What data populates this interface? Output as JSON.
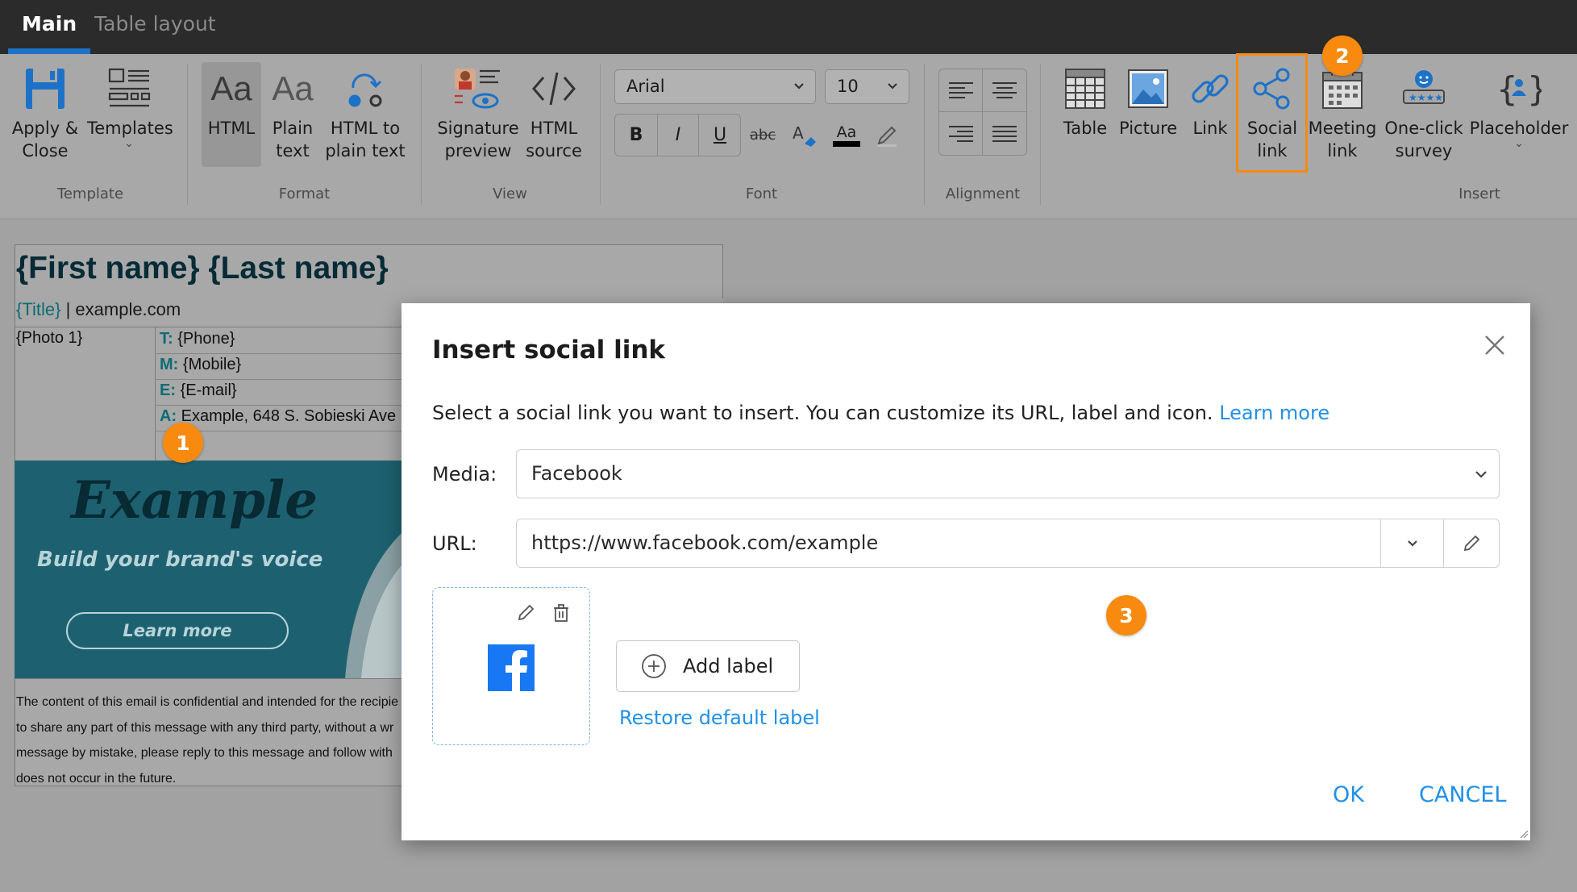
{
  "tabs": [
    {
      "label": "Main",
      "active": true
    },
    {
      "label": "Table layout",
      "active": false
    }
  ],
  "ribbon": {
    "groups": {
      "template": "Template",
      "format": "Format",
      "view": "View",
      "font": "Font",
      "alignment": "Alignment",
      "insert": "Insert"
    },
    "apply_close": {
      "line1": "Apply &",
      "line2": "Close"
    },
    "templates": "Templates",
    "html": "HTML",
    "plain_text": {
      "line1": "Plain",
      "line2": "text"
    },
    "html_to_plain": {
      "line1": "HTML to",
      "line2": "plain text"
    },
    "signature_preview": {
      "line1": "Signature",
      "line2": "preview"
    },
    "html_source": {
      "line1": "HTML",
      "line2": "source"
    },
    "font_name": "Arial",
    "font_size": "10",
    "bold": "B",
    "italic": "I",
    "underline": "U",
    "strike": "abc",
    "font_color_sample": "Aa",
    "table": "Table",
    "picture": "Picture",
    "link": "Link",
    "social_link": {
      "line1": "Social",
      "line2": "link"
    },
    "meeting_link": {
      "line1": "Meeting",
      "line2": "link"
    },
    "survey": {
      "line1": "One-click",
      "line2": "survey"
    },
    "placeholder": "Placeholder"
  },
  "document": {
    "name": "{First name} {Last name}",
    "title_ph": "{Title}",
    "sep": " | ",
    "site": "example.com",
    "photo": "{Photo 1}",
    "contacts": [
      {
        "key": "T:",
        "value": "{Phone}"
      },
      {
        "key": "M:",
        "value": "{Mobile}"
      },
      {
        "key": "E:",
        "value": "{E-mail}"
      },
      {
        "key": "A:",
        "value": "Example, 648 S. Sobieski Ave"
      }
    ],
    "banner": {
      "brand": "Example",
      "tagline": "Build your brand's voice",
      "cta": "Learn more"
    },
    "disclaimer": [
      "The content of this email is confidential and intended for the recipie",
      "to share any part of this message with any third party, without a wr",
      "message by mistake, please reply to this message and follow with",
      "does not occur in the future."
    ]
  },
  "markers": [
    "1",
    "2",
    "3"
  ],
  "dialog": {
    "title": "Insert social link",
    "description": "Select a social link you want to insert. You can customize its URL, label and icon.",
    "learn_more": "Learn more",
    "media_label": "Media:",
    "media_value": "Facebook",
    "url_label": "URL:",
    "url_value": "https://www.facebook.com/example",
    "add_label": "Add label",
    "restore_label": "Restore default label",
    "ok": "OK",
    "cancel": "CANCEL"
  },
  "colors": {
    "accent": "#1d72c7",
    "link": "#2190e8",
    "highlight": "#f88a10",
    "facebook": "#1877f2"
  }
}
